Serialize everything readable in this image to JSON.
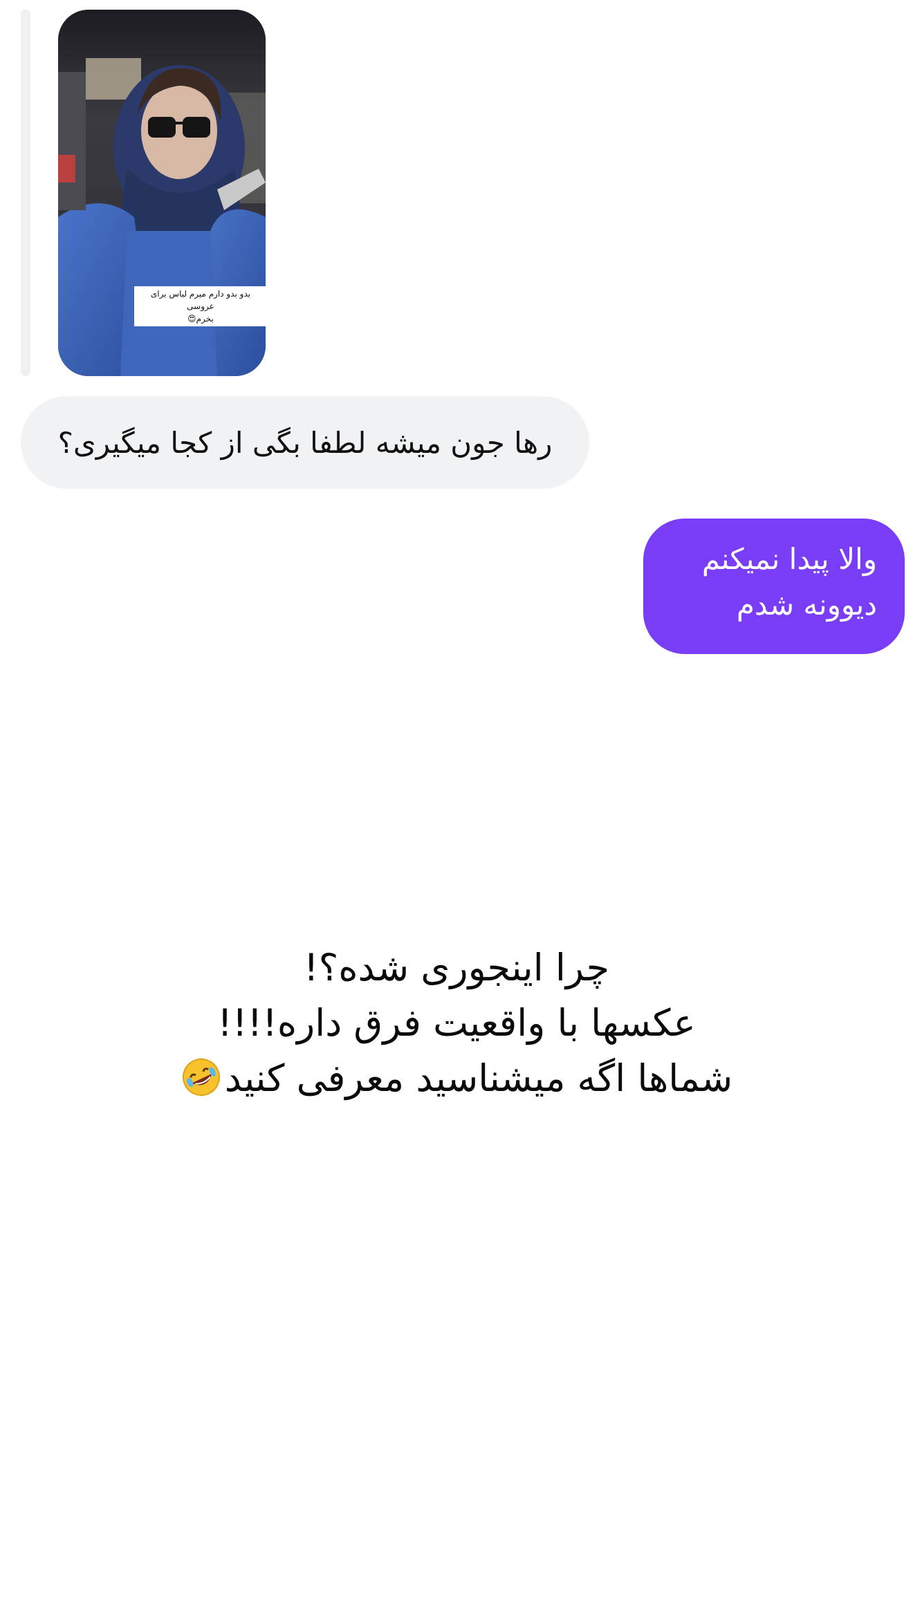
{
  "story_reply": {
    "caption_line1": "بدو بدو دارم میرم لباس برای عروسی",
    "caption_line2": "بخرم😍"
  },
  "messages": {
    "incoming_text": "رها جون میشه لطفا بگی از کجا میگیری؟",
    "outgoing_line1": "والا پیدا نمیکنم",
    "outgoing_line2": "دیوونه شدم"
  },
  "overlay_caption": {
    "line1": "چرا اینجوری شده؟!",
    "line2": "عکسها با واقعیت فرق داره!!!!",
    "line3": "شماها اگه میشناسید معرفی کنید"
  },
  "colors": {
    "incoming_bubble": "#f1f2f4",
    "outgoing_bubble": "#7a3df6"
  },
  "icons": {
    "laughing": "rolling-on-floor-laughing-emoji"
  }
}
